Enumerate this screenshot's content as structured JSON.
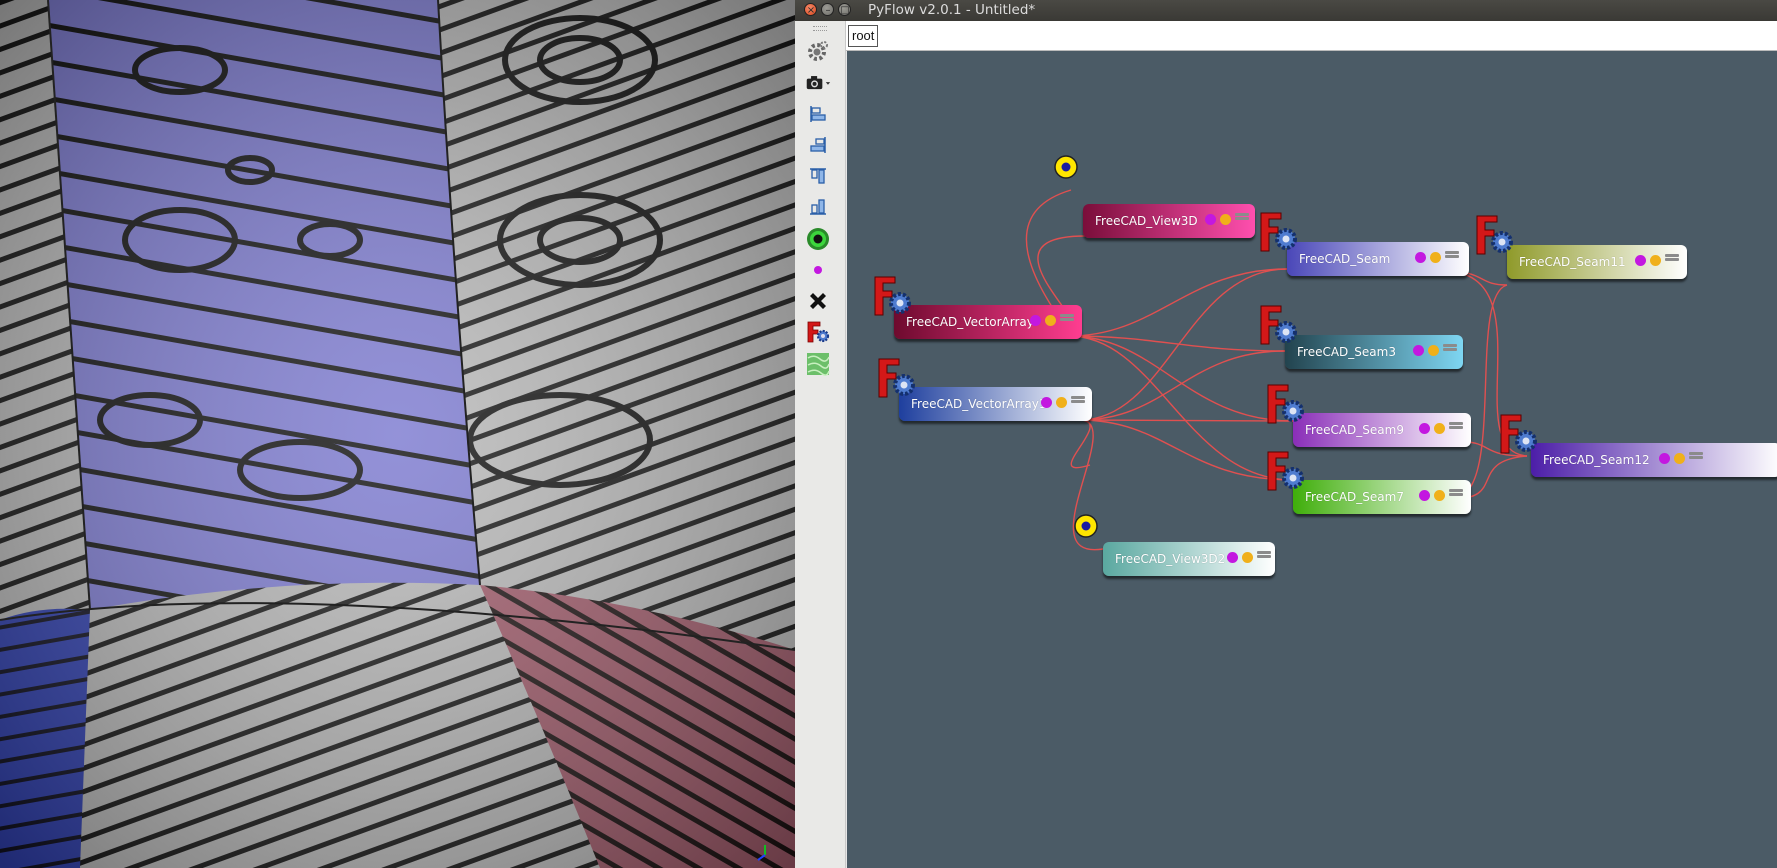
{
  "window": {
    "title": "PyFlow v2.0.1 - Untitled*",
    "close_glyph": "×",
    "min_glyph": "–",
    "max_glyph": "□"
  },
  "toolbar": {
    "items": [
      {
        "name": "settings-gear-icon"
      },
      {
        "name": "camera-icon"
      },
      {
        "name": "align-left-icon"
      },
      {
        "name": "align-right-icon"
      },
      {
        "name": "align-top-icon"
      },
      {
        "name": "align-bottom-icon"
      },
      {
        "name": "green-eye-icon"
      },
      {
        "name": "purple-dot-icon"
      },
      {
        "name": "black-cross-icon"
      },
      {
        "name": "freecad-f-icon"
      },
      {
        "name": "texture-map-icon"
      }
    ]
  },
  "breadcrumb": {
    "root": "root"
  },
  "nodes": [
    {
      "id": "view3d",
      "label": "FreeCAD_View3D",
      "color_start": "#7a0e3a",
      "color_end": "#ff4fae"
    },
    {
      "id": "seam",
      "label": "FreeCAD_Seam",
      "color_start": "#4a47b8",
      "color_end": "#ffffff"
    },
    {
      "id": "seam11",
      "label": "FreeCAD_Seam11",
      "color_start": "#8f9a2a",
      "color_end": "#ffffff"
    },
    {
      "id": "vectorarray",
      "label": "FreeCAD_VectorArray",
      "color_start": "#6e0a2e",
      "color_end": "#ff3d90"
    },
    {
      "id": "seam3",
      "label": "FreeCAD_Seam3",
      "color_start": "#22434e",
      "color_end": "#7ed6f2"
    },
    {
      "id": "vectorarray1",
      "label": "FreeCAD_VectorArray1",
      "color_start": "#1e3f9e",
      "color_end": "#ffffff"
    },
    {
      "id": "seam9",
      "label": "FreeCAD_Seam9",
      "color_start": "#8a2eb8",
      "color_end": "#ffffff"
    },
    {
      "id": "seam12",
      "label": "FreeCAD_Seam12",
      "color_start": "#4c1ea8",
      "color_end": "#ffffff"
    },
    {
      "id": "seam7",
      "label": "FreeCAD_Seam7",
      "color_start": "#3fae0a",
      "color_end": "#ffffff"
    },
    {
      "id": "view3d2",
      "label": "FreeCAD_View3D2",
      "color_start": "#5aa8a0",
      "color_end": "#ffffff"
    }
  ],
  "colors": {
    "canvas_bg": "#4b5b66",
    "wire": "#e05050",
    "reroute_fill": "#ffe600",
    "reroute_dot": "#1a1aa0"
  }
}
